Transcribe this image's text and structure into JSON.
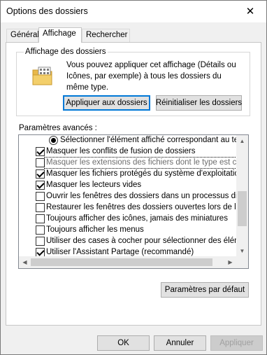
{
  "window": {
    "title": "Options des dossiers",
    "close_glyph": "✕"
  },
  "tabs": [
    {
      "label": "Général",
      "active": false
    },
    {
      "label": "Affichage",
      "active": true
    },
    {
      "label": "Rechercher",
      "active": false
    }
  ],
  "folder_view": {
    "title": "Affichage des dossiers",
    "description": "Vous pouvez appliquer cet affichage (Détails ou Icônes, par exemple) à tous les dossiers du même type.",
    "apply_button": "Appliquer aux dossiers",
    "reset_button": "Réinitialiser les dossiers",
    "icon": "folder-view-icon"
  },
  "advanced": {
    "label": "Paramètres avancés :",
    "items": [
      {
        "type": "radio",
        "checked": true,
        "text": "Sélectionner l'élément affiché correspondant au texte"
      },
      {
        "type": "checkbox",
        "checked": true,
        "text": "Masquer les conflits de fusion de dossiers"
      },
      {
        "type": "checkbox",
        "checked": false,
        "focused": true,
        "text": "Masquer les extensions des fichiers dont le type est connu"
      },
      {
        "type": "checkbox",
        "checked": true,
        "text": "Masquer les fichiers protégés du système d'exploitation (re"
      },
      {
        "type": "checkbox",
        "checked": true,
        "text": "Masquer les lecteurs vides"
      },
      {
        "type": "checkbox",
        "checked": false,
        "text": "Ouvrir les fenêtres des dossiers dans un processus différe"
      },
      {
        "type": "checkbox",
        "checked": false,
        "text": "Restaurer les fenêtres des dossiers ouvertes lors de la pro"
      },
      {
        "type": "checkbox",
        "checked": false,
        "text": "Toujours afficher des icônes, jamais des miniatures"
      },
      {
        "type": "checkbox",
        "checked": false,
        "text": "Toujours afficher les menus"
      },
      {
        "type": "checkbox",
        "checked": false,
        "text": "Utiliser des cases à cocher pour sélectionner des élément"
      },
      {
        "type": "checkbox",
        "checked": true,
        "text": "Utiliser l'Assistant Partage (recommandé)"
      }
    ],
    "defaults_button": "Paramètres par défaut"
  },
  "footer": {
    "ok": "OK",
    "cancel": "Annuler",
    "apply": "Appliquer"
  },
  "colors": {
    "accent": "#0078d7",
    "window_bg": "#f0f0f0",
    "panel_bg": "#ffffff"
  }
}
